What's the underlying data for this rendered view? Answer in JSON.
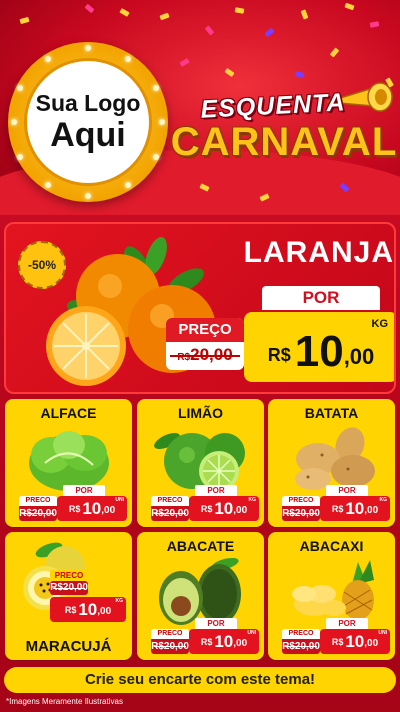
{
  "logo": {
    "line1": "Sua Logo",
    "line2": "Aqui"
  },
  "campaign": {
    "line1": "ESQUENTA",
    "line2": "CARNAVAL"
  },
  "featured": {
    "discount": "-50%",
    "name": "LARANJA",
    "por_label": "POR",
    "preco_label": "PREÇO",
    "old_currency": "R$",
    "old_price": "20,00",
    "currency": "R$",
    "price_int": "10",
    "price_dec": ",00",
    "unit": "KG"
  },
  "products": [
    {
      "name": "ALFACE",
      "preco_label": "PRECO",
      "old": "R$20,00",
      "por": "POR",
      "cur": "R$",
      "int": "10",
      "dec": ",00",
      "unit": "UNI",
      "icon": "lettuce-icon"
    },
    {
      "name": "LIMÃO",
      "preco_label": "PRECO",
      "old": "R$20,00",
      "por": "POR",
      "cur": "R$",
      "int": "10",
      "dec": ",00",
      "unit": "KG",
      "icon": "lime-icon"
    },
    {
      "name": "BATATA",
      "preco_label": "PRECO",
      "old": "R$20,00",
      "por": "POR",
      "cur": "R$",
      "int": "10",
      "dec": ",00",
      "unit": "KG",
      "icon": "potato-icon"
    },
    {
      "name": "MARACUJÁ",
      "preco_label": "PRECO",
      "old": "R$20,00",
      "por": "POR",
      "cur": "R$",
      "int": "10",
      "dec": ",00",
      "unit": "KG",
      "icon": "passionfruit-icon"
    },
    {
      "name": "ABACATE",
      "preco_label": "PRECO",
      "old": "R$20,00",
      "por": "POR",
      "cur": "R$",
      "int": "10",
      "dec": ",00",
      "unit": "UNI",
      "icon": "avocado-icon"
    },
    {
      "name": "ABACAXI",
      "preco_label": "PRECO",
      "old": "R$20,00",
      "por": "POR",
      "cur": "R$",
      "int": "10",
      "dec": ",00",
      "unit": "UNI",
      "icon": "pineapple-icon"
    }
  ],
  "cta": "Crie seu encarte com este tema!",
  "disclaimer": "*Imagens Meramente Ilustrativas",
  "colors": {
    "red": "#d20f1f",
    "yellow": "#ffd400",
    "gold": "#ffc21a"
  }
}
